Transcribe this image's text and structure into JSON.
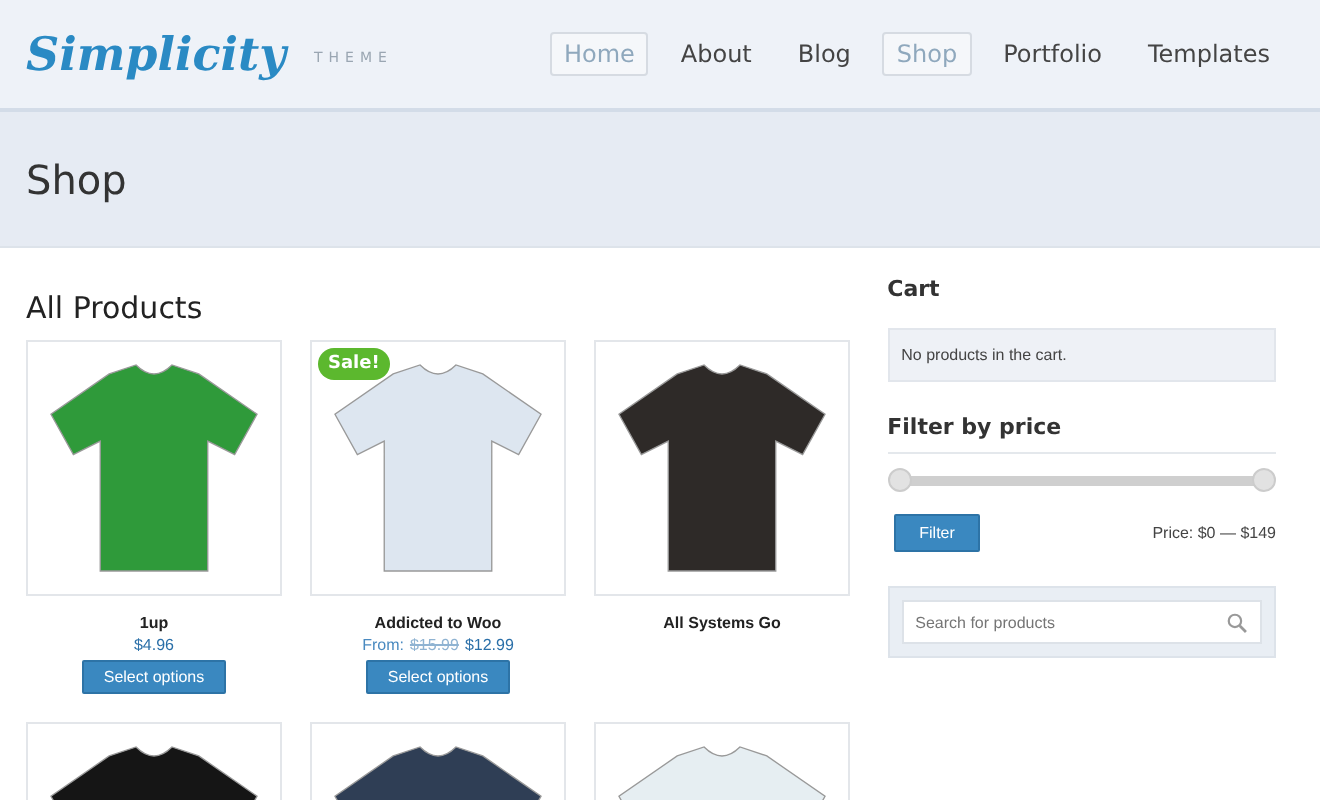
{
  "header": {
    "logo": "Simplicity",
    "tagline": "THEME",
    "nav": [
      {
        "label": "Home",
        "selected": true
      },
      {
        "label": "About",
        "selected": false
      },
      {
        "label": "Blog",
        "selected": false
      },
      {
        "label": "Shop",
        "selected": true
      },
      {
        "label": "Portfolio",
        "selected": false
      },
      {
        "label": "Templates",
        "selected": false
      }
    ]
  },
  "page_title": "Shop",
  "products_heading": "All Products",
  "products": [
    {
      "name": "1up",
      "sale": false,
      "color": "#2f9a3a",
      "price": "$4.96",
      "button": "Select options"
    },
    {
      "name": "Addicted to Woo",
      "sale": true,
      "sale_label": "Sale!",
      "color": "#dde6f0",
      "price_prefix": "From:",
      "old_price": "$15.99",
      "price": "$12.99",
      "button": "Select options"
    },
    {
      "name": "All Systems Go",
      "sale": false,
      "color": "#2e2a28"
    },
    {
      "sale": false,
      "color": "#151515"
    },
    {
      "sale": false,
      "color": "#2f3e55"
    },
    {
      "sale": false,
      "color": "#e6eef2"
    }
  ],
  "sidebar": {
    "cart_title": "Cart",
    "cart_text": "No products in the cart.",
    "filter_title": "Filter by price",
    "slider": {
      "level": 1
    },
    "filter_button": "Filter",
    "price_range": "Price: $0 — $149",
    "search": {
      "placeholder": "Search for products"
    }
  }
}
